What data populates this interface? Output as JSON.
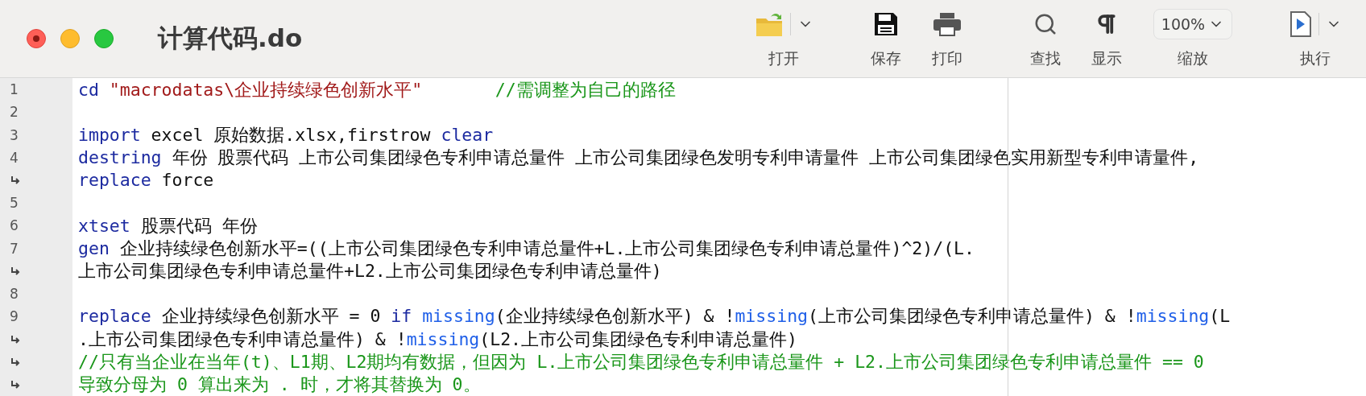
{
  "window": {
    "title": "计算代码.do"
  },
  "toolbar": [
    {
      "kind": "folder",
      "label": "打开",
      "menu": true
    },
    {
      "kind": "floppy",
      "label": "保存",
      "menu": false
    },
    {
      "kind": "printer",
      "label": "打印",
      "menu": false
    },
    {
      "kind": "search",
      "label": "查找",
      "menu": false
    },
    {
      "kind": "pilcrow",
      "label": "显示",
      "menu": false
    },
    {
      "kind": "select",
      "label": "缩放",
      "value": "100%"
    },
    {
      "kind": "play",
      "label": "执行",
      "menu": true
    }
  ],
  "editor": {
    "lines": [
      {
        "kind": "number",
        "gutter": "1",
        "segments": [
          {
            "kind": "keyword",
            "text": "cd "
          },
          {
            "kind": "string",
            "text": "\"macrodatas\\企业持续绿色创新水平\"       "
          },
          {
            "kind": "comment",
            "text": "//需调整为自己的路径"
          }
        ]
      },
      {
        "kind": "number",
        "gutter": "2"
      },
      {
        "kind": "number",
        "gutter": "3",
        "segments": [
          {
            "kind": "keyword",
            "text": "import"
          },
          {
            "kind": "plain",
            "text": " excel 原始数据.xlsx,firstrow "
          },
          {
            "kind": "keyword",
            "text": "clear"
          }
        ]
      },
      {
        "kind": "number",
        "gutter": "4",
        "segments": [
          {
            "kind": "keyword",
            "text": "destring"
          },
          {
            "kind": "plain",
            "text": " 年份 股票代码 上市公司集团绿色专利申请总量件 上市公司集团绿色发明专利申请量件 上市公司集团绿色实用新型专利申请量件,"
          }
        ]
      },
      {
        "kind": "wrap",
        "segments": [
          {
            "kind": "keyword",
            "text": "replace"
          },
          {
            "kind": "plain",
            "text": " force"
          }
        ]
      },
      {
        "kind": "number",
        "gutter": "5"
      },
      {
        "kind": "number",
        "gutter": "6",
        "segments": [
          {
            "kind": "keyword",
            "text": "xtset"
          },
          {
            "kind": "plain",
            "text": " 股票代码 年份"
          }
        ]
      },
      {
        "kind": "number",
        "gutter": "7",
        "segments": [
          {
            "kind": "keyword",
            "text": "gen"
          },
          {
            "kind": "plain",
            "text": " 企业持续绿色创新水平=((上市公司集团绿色专利申请总量件+L.上市公司集团绿色专利申请总量件)^2)/(L."
          }
        ]
      },
      {
        "kind": "wrap",
        "segments": [
          {
            "kind": "plain",
            "text": "上市公司集团绿色专利申请总量件+L2.上市公司集团绿色专利申请总量件)"
          }
        ]
      },
      {
        "kind": "number",
        "gutter": "8"
      },
      {
        "kind": "number",
        "gutter": "9",
        "segments": [
          {
            "kind": "keyword",
            "text": "replace"
          },
          {
            "kind": "plain",
            "text": " 企业持续绿色创新水平 = 0 "
          },
          {
            "kind": "keyword",
            "text": "if "
          },
          {
            "kind": "function",
            "text": "missing"
          },
          {
            "kind": "plain",
            "text": "(企业持续绿色创新水平) & !"
          },
          {
            "kind": "function",
            "text": "missing"
          },
          {
            "kind": "plain",
            "text": "(上市公司集团绿色专利申请总量件) & !"
          },
          {
            "kind": "function",
            "text": "missing"
          },
          {
            "kind": "plain",
            "text": "(L"
          }
        ]
      },
      {
        "kind": "wrap",
        "segments": [
          {
            "kind": "plain",
            "text": ".上市公司集团绿色专利申请总量件) & !"
          },
          {
            "kind": "function",
            "text": "missing"
          },
          {
            "kind": "plain",
            "text": "(L2.上市公司集团绿色专利申请总量件)"
          }
        ]
      },
      {
        "kind": "wrap",
        "segments": [
          {
            "kind": "comment",
            "text": "//只有当企业在当年(t)、L1期、L2期均有数据，但因为 L.上市公司集团绿色专利申请总量件 + L2.上市公司集团绿色专利申请总量件 == 0"
          }
        ]
      },
      {
        "kind": "wrap",
        "segments": [
          {
            "kind": "comment",
            "text": "导致分母为 0 算出来为 . 时，才将其替换为 0。"
          }
        ]
      }
    ]
  }
}
